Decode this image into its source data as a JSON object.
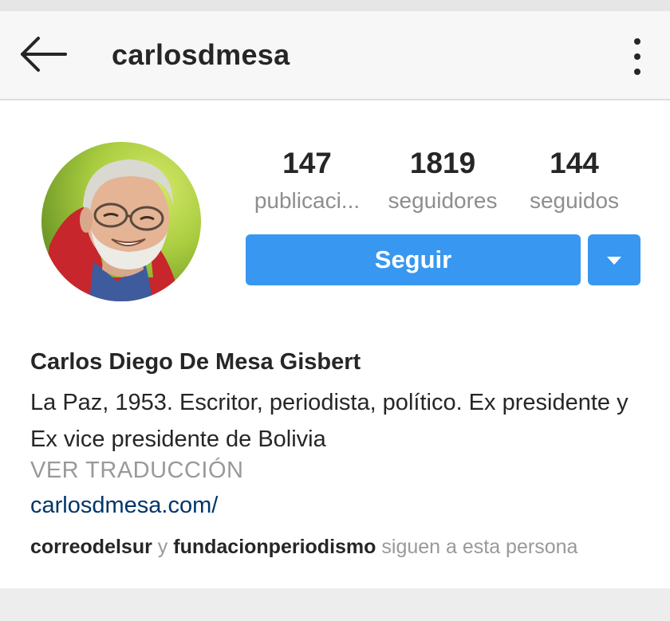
{
  "header": {
    "username": "carlosdmesa",
    "back_icon": "arrow-left-icon",
    "menu_icon": "more-vertical-icon"
  },
  "profile": {
    "avatar_icon": "profile-photo",
    "stats": [
      {
        "value": "147",
        "label": "publicaci..."
      },
      {
        "value": "1819",
        "label": "seguidores"
      },
      {
        "value": "144",
        "label": "seguidos"
      }
    ],
    "follow_label": "Seguir",
    "dropdown_icon": "caret-down-icon",
    "full_name": "Carlos Diego De Mesa Gisbert",
    "bio": "La Paz, 1953. Escritor, periodista, político. Ex presidente y Ex vice presidente de Bolivia",
    "translate_label": "VER TRADUCCIÓN",
    "website": "carlosdmesa.com/",
    "followed_by": {
      "user1": "correodelsur",
      "connector": "y",
      "user2": "fundacionperiodismo",
      "suffix": "siguen a esta persona"
    }
  },
  "colors": {
    "accent": "#3897f0",
    "link": "#003569",
    "muted": "#8e8e8e",
    "text": "#262626"
  }
}
